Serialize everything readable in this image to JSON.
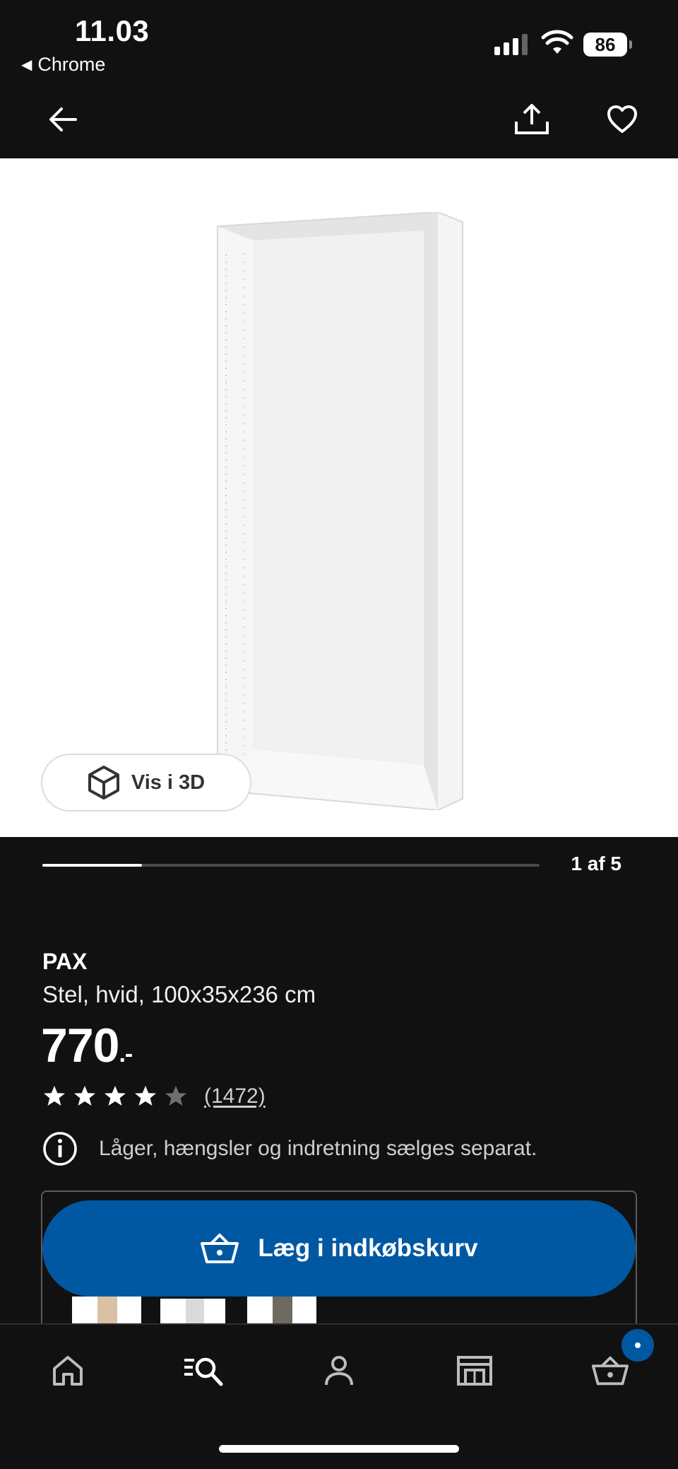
{
  "status_bar": {
    "time": "11.03",
    "back_app": "Chrome",
    "battery": "86"
  },
  "product": {
    "name": "PAX",
    "description": "Stel, hvid, 100x35x236 cm",
    "price_integer": "770",
    "price_decimal": ".-",
    "rating_stars": 4,
    "rating_max": 5,
    "review_count": "(1472)",
    "notice": "Låger, hængsler og indretning sælges separat."
  },
  "gallery": {
    "view_3d_label": "Vis i 3D",
    "counter": "1 af 5",
    "progress_fraction": 0.2
  },
  "cta": {
    "add_to_cart_label": "Læg i indkøbskurv"
  },
  "colors": {
    "background": "#111111",
    "accent_blue": "#0058a3",
    "text_primary": "#ffffff",
    "text_secondary": "#cfcfcf"
  },
  "icons": {
    "nav": [
      "back-arrow-icon",
      "share-icon",
      "heart-icon"
    ],
    "tabbar": [
      "home-icon",
      "search-list-icon",
      "profile-icon",
      "store-icon",
      "basket-icon"
    ]
  }
}
